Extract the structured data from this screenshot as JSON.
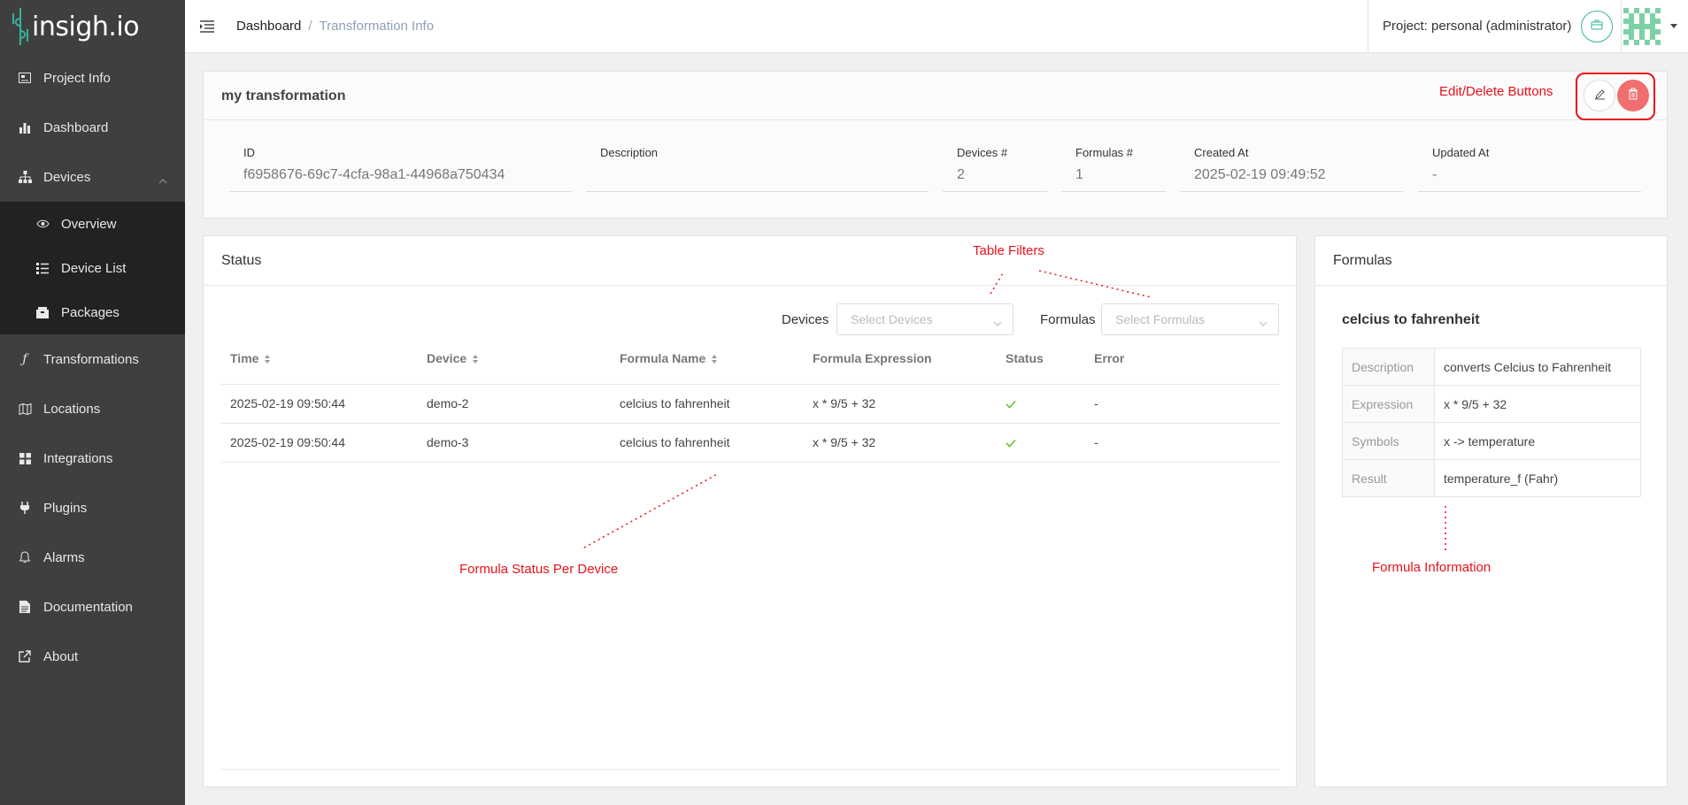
{
  "app": {
    "logo_text": "insigh.io"
  },
  "sidebar": {
    "items": [
      {
        "label": "Project Info",
        "icon": "image-icon"
      },
      {
        "label": "Dashboard",
        "icon": "bar-chart-icon"
      },
      {
        "label": "Devices",
        "icon": "sitemap-icon"
      },
      {
        "label": "Transformations",
        "icon": "function-icon"
      },
      {
        "label": "Locations",
        "icon": "map-icon"
      },
      {
        "label": "Integrations",
        "icon": "grid-icon"
      },
      {
        "label": "Plugins",
        "icon": "plug-icon"
      },
      {
        "label": "Alarms",
        "icon": "bell-icon"
      },
      {
        "label": "Documentation",
        "icon": "file-icon"
      },
      {
        "label": "About",
        "icon": "external-link-icon"
      }
    ],
    "devices_sub": [
      {
        "label": "Overview",
        "icon": "eye-icon"
      },
      {
        "label": "Device List",
        "icon": "list-icon"
      },
      {
        "label": "Packages",
        "icon": "box-icon"
      }
    ]
  },
  "header": {
    "breadcrumb": {
      "home": "Dashboard",
      "separator": "/",
      "current": "Transformation Info"
    },
    "project": "Project: personal (administrator)"
  },
  "transformation": {
    "title": "my transformation",
    "fields": {
      "id_label": "ID",
      "id_value": "f6958676-69c7-4cfa-98a1-44968a750434",
      "description_label": "Description",
      "description_value": "",
      "devices_label": "Devices #",
      "devices_value": "2",
      "formulas_label": "Formulas #",
      "formulas_value": "1",
      "created_label": "Created At",
      "created_value": "2025-02-19 09:49:52",
      "updated_label": "Updated At",
      "updated_value": "-"
    }
  },
  "status": {
    "title": "Status",
    "filters": {
      "devices_label": "Devices",
      "devices_placeholder": "Select Devices",
      "formulas_label": "Formulas",
      "formulas_placeholder": "Select Formulas"
    },
    "columns": [
      "Time",
      "Device",
      "Formula Name",
      "Formula Expression",
      "Status",
      "Error"
    ],
    "rows": [
      {
        "time": "2025-02-19 09:50:44",
        "device": "demo-2",
        "formula_name": "celcius to fahrenheit",
        "expression": "x * 9/5 + 32",
        "status": "ok",
        "error": "-"
      },
      {
        "time": "2025-02-19 09:50:44",
        "device": "demo-3",
        "formula_name": "celcius to fahrenheit",
        "expression": "x * 9/5 + 32",
        "status": "ok",
        "error": "-"
      }
    ]
  },
  "formulas": {
    "title": "Formulas",
    "name": "celcius to fahrenheit",
    "details": [
      {
        "key": "Description",
        "value": "converts Celcius to Fahrenheit"
      },
      {
        "key": "Expression",
        "value": "x * 9/5 + 32"
      },
      {
        "key": "Symbols",
        "value": "x -> temperature"
      },
      {
        "key": "Result",
        "value": "temperature_f (Fahr)"
      }
    ]
  },
  "annotations": {
    "edit_delete": "Edit/Delete Buttons",
    "table_filters": "Table Filters",
    "formula_status": "Formula Status Per Device",
    "formula_info": "Formula Information"
  },
  "colors": {
    "accent": "#36b39a",
    "sidebar": "#3f3f3f",
    "danger": "#f06e6e",
    "annotation": "#e8111b"
  }
}
